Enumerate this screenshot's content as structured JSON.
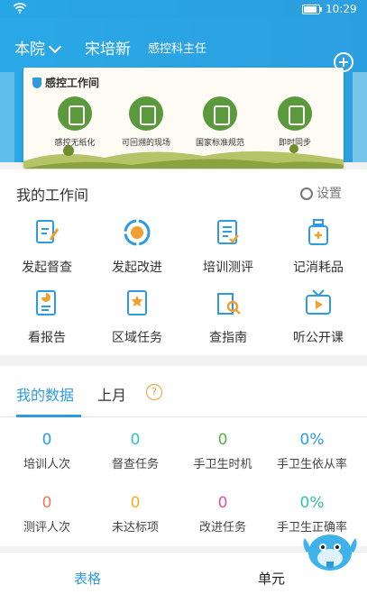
{
  "status": {
    "time": "10:29",
    "battery_level": 0.85
  },
  "header": {
    "hospital": "本院",
    "user_name": "宋培新",
    "role": "感控科主任"
  },
  "banner": {
    "brand": "感控工作间",
    "features": [
      {
        "label": "感控无纸化",
        "icon": "tablet-icon"
      },
      {
        "label": "可回溯的现场",
        "icon": "refresh-icon"
      },
      {
        "label": "国家标准规范",
        "icon": "medal-icon"
      },
      {
        "label": "即时同步",
        "icon": "sync-icon"
      }
    ]
  },
  "workspace": {
    "title": "我的工作间",
    "settings": "设置",
    "tiles": [
      {
        "label": "发起督查",
        "icon": "edit-doc-icon"
      },
      {
        "label": "发起改进",
        "icon": "pdca-icon"
      },
      {
        "label": "培训测评",
        "icon": "checklist-icon"
      },
      {
        "label": "记消耗品",
        "icon": "bottle-plus-icon"
      },
      {
        "label": "看报告",
        "icon": "report-icon"
      },
      {
        "label": "区域任务",
        "icon": "star-flag-icon"
      },
      {
        "label": "查指南",
        "icon": "guide-search-icon"
      },
      {
        "label": "听公开课",
        "icon": "tv-play-icon"
      }
    ]
  },
  "data": {
    "tabs": [
      "我的数据",
      "上月"
    ],
    "help": "?",
    "stats": [
      {
        "value": "0",
        "label": "培训人次",
        "color": "#2e9be0"
      },
      {
        "value": "0",
        "label": "督查任务",
        "color": "#34c3c3"
      },
      {
        "value": "0",
        "label": "手卫生时机",
        "color": "#58b548"
      },
      {
        "value": "0%",
        "label": "手卫生依从率",
        "color": "#2e9be0"
      },
      {
        "value": "0",
        "label": "测评人次",
        "color": "#f07a5a"
      },
      {
        "value": "0",
        "label": "未达标项",
        "color": "#f0b020"
      },
      {
        "value": "0",
        "label": "改进任务",
        "color": "#e0559a"
      },
      {
        "value": "0%",
        "label": "手卫生正确率",
        "color": "#34c3a0"
      }
    ]
  },
  "bottom": {
    "left": "表格",
    "right": "单元"
  }
}
